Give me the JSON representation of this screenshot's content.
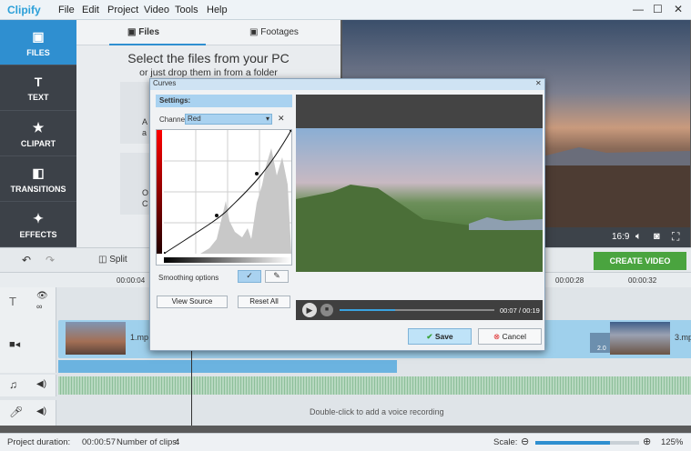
{
  "app": {
    "title": "Clipify"
  },
  "menu": [
    "File",
    "Edit",
    "Project",
    "Video",
    "Tools",
    "Help"
  ],
  "window": {
    "minimize": "—",
    "maximize": "☐",
    "close": "✕"
  },
  "sidebar": {
    "items": [
      {
        "label": "FILES",
        "icon": "film-icon",
        "active": true
      },
      {
        "label": "TEXT",
        "icon": "text-icon"
      },
      {
        "label": "CLIPART",
        "icon": "star-icon"
      },
      {
        "label": "TRANSITIONS",
        "icon": "transitions-icon"
      },
      {
        "label": "EFFECTS",
        "icon": "wand-icon"
      }
    ]
  },
  "files_panel": {
    "tabs": [
      "Files",
      "Footages"
    ],
    "heading": "Select the files from your PC",
    "subheading": "or just drop them in from a folder",
    "card1_fragment": "A\na",
    "card2_fragment": "O\nC"
  },
  "preview_bar": {
    "aspect": "16:9"
  },
  "toolbar": {
    "split_label": "Split",
    "create_video_label": "CREATE VIDEO"
  },
  "ruler": {
    "ticks": [
      "00:00:04",
      "00:00:28",
      "00:00:32"
    ]
  },
  "tracks": {
    "clip1_label": "1.mp",
    "clip3_label": "3.mp",
    "transition_duration": "2.0",
    "voice_hint": "Double-click to add a voice recording"
  },
  "status": {
    "duration_label": "Project duration:",
    "duration_value": "00:00:57",
    "clips_label": "Number of clips:",
    "clips_value": "4",
    "scale_label": "Scale:",
    "scale_value": "125%",
    "scale_level": 0.72
  },
  "dialog": {
    "title": "Curves",
    "settings_label": "Settings:",
    "channel_label": "Channel",
    "channel_value": "Red",
    "smoothing_label": "Smoothing options",
    "view_source_label": "View Source",
    "reset_all_label": "Reset All",
    "time_display": "00:07 / 00:19",
    "save_label": "Save",
    "cancel_label": "Cancel",
    "progress": 0.36
  },
  "colors": {
    "accent": "#2f8fd0",
    "create": "#4aa43f",
    "save_bg": "#bfe3f8"
  }
}
